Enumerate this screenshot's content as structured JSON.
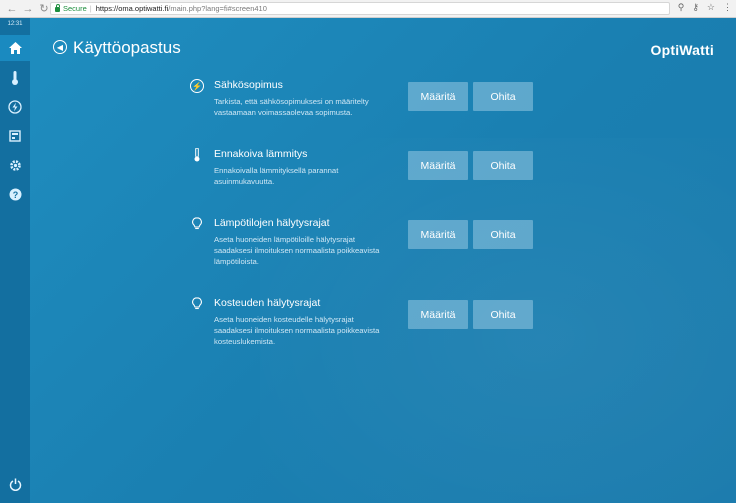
{
  "browser": {
    "secure_label": "Secure",
    "url_host": "https://oma.optiwatti.fi",
    "url_path": "/main.php?lang=fi#screen410"
  },
  "sidebar": {
    "clock": "12:31",
    "items": [
      {
        "name": "home",
        "active": true
      },
      {
        "name": "temperature"
      },
      {
        "name": "energy"
      },
      {
        "name": "reports"
      },
      {
        "name": "settings"
      },
      {
        "name": "help"
      }
    ]
  },
  "header": {
    "title": "Käyttöopastus",
    "brand": "OptiWatti"
  },
  "guide": {
    "define_label": "Määritä",
    "skip_label": "Ohita",
    "items": [
      {
        "title": "Sähkösopimus",
        "description": "Tarkista, että sähkösopimuksesi on määritelty vastaamaan voimassaolevaa sopimusta.",
        "icon": "electricity-icon"
      },
      {
        "title": "Ennakoiva lämmitys",
        "description": "Ennakoivalla lämmityksellä parannat asuinmukavuutta.",
        "icon": "thermometer-icon"
      },
      {
        "title": "Lämpötilojen hälytysrajat",
        "description": "Aseta huoneiden lämpötiloille hälytysrajat saadaksesi ilmoituksen normaalista poikkeavista lämpötiloista.",
        "icon": "bulb-icon"
      },
      {
        "title": "Kosteuden hälytysrajat",
        "description": "Aseta huoneiden kosteudelle hälytysrajat saadaksesi ilmoituksen normaalista poikkeavista kosteuslukemista.",
        "icon": "bulb-icon"
      }
    ]
  }
}
